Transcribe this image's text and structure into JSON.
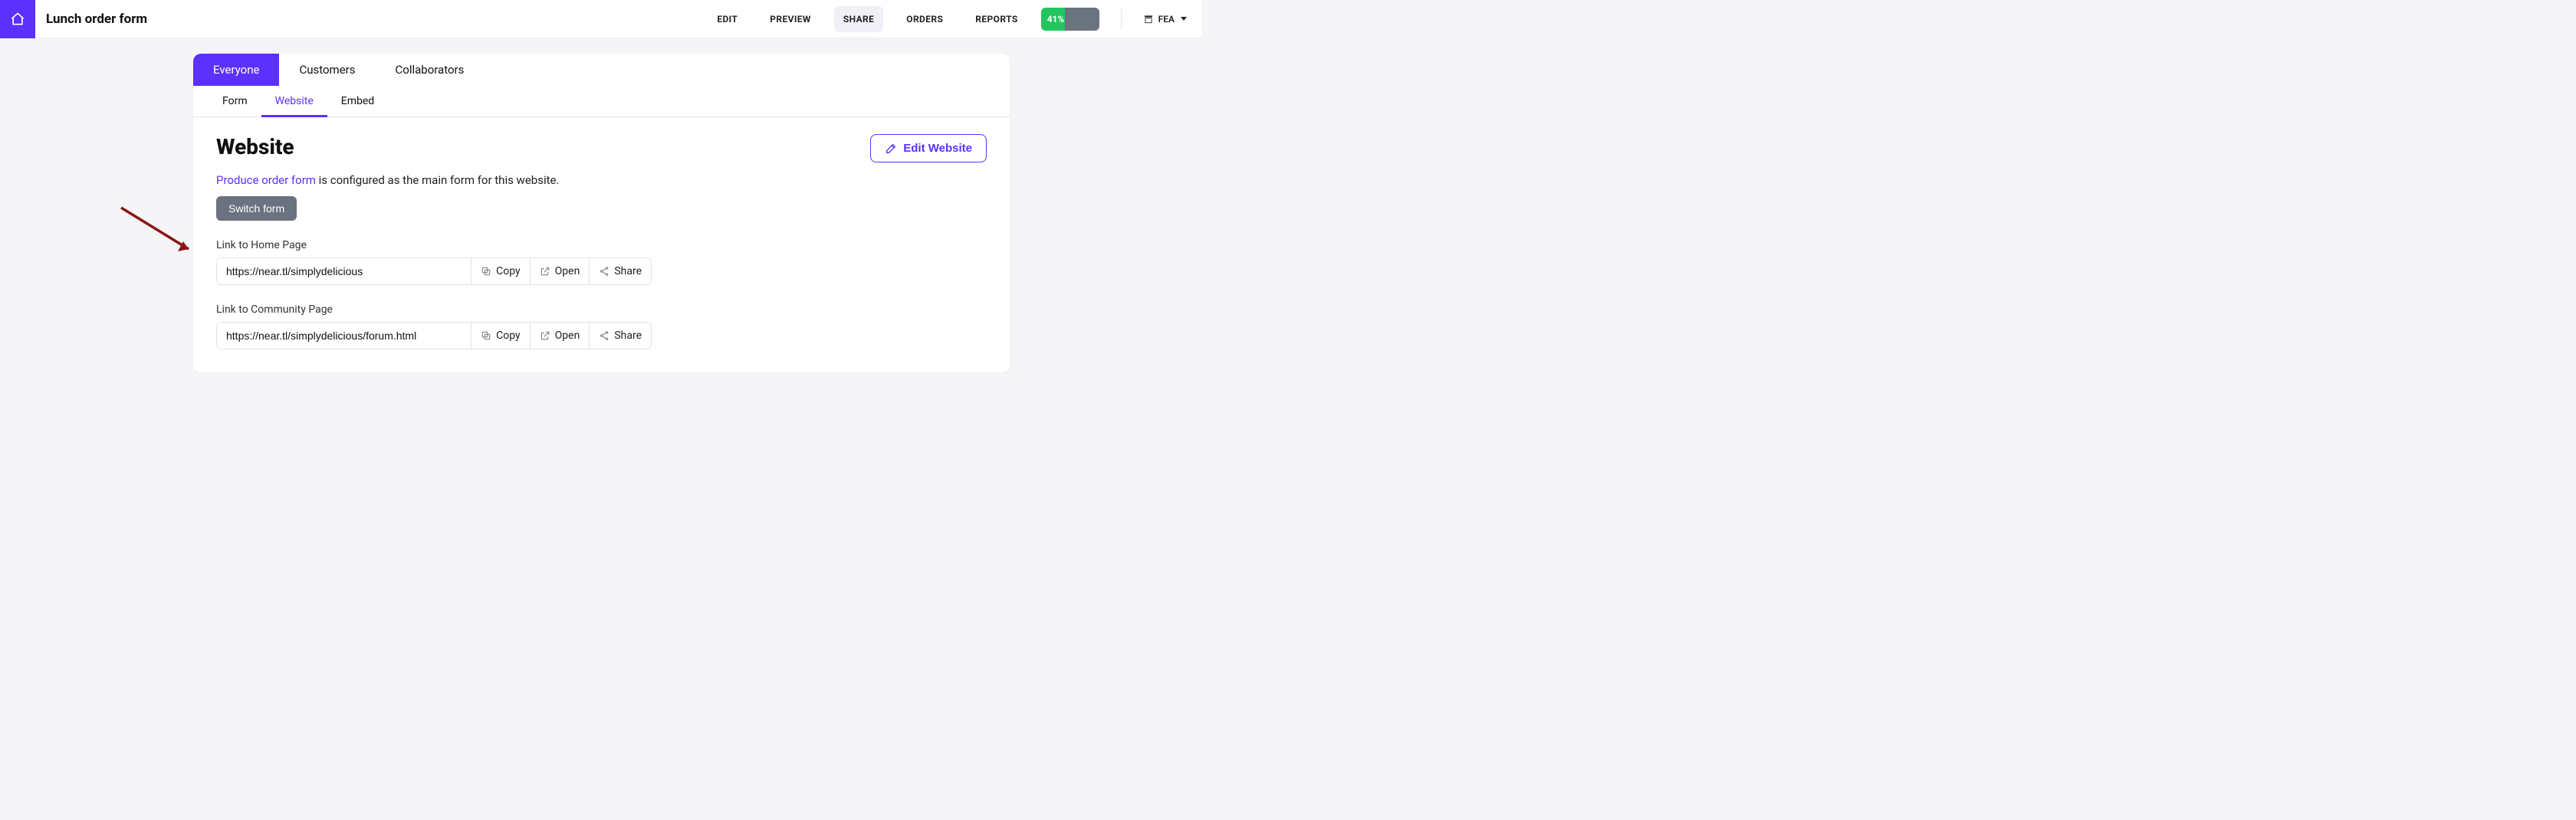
{
  "header": {
    "title": "Lunch order form",
    "nav": {
      "edit": "EDIT",
      "preview": "PREVIEW",
      "share": "SHARE",
      "orders": "ORDERS",
      "reports": "REPORTS"
    },
    "progress_label": "41%",
    "account_label": "FEA"
  },
  "tabs": {
    "everyone": "Everyone",
    "customers": "Customers",
    "collaborators": "Collaborators"
  },
  "subtabs": {
    "form": "Form",
    "website": "Website",
    "embed": "Embed"
  },
  "section": {
    "title": "Website",
    "edit_button": "Edit Website",
    "configured_link_text": "Produce order form",
    "configured_suffix": " is configured as the main form for this website.",
    "switch_button": "Switch form",
    "home": {
      "label": "Link to Home Page",
      "url": "https://near.tl/simplydelicious"
    },
    "community": {
      "label": "Link to Community Page",
      "url": "https://near.tl/simplydelicious/forum.html"
    },
    "actions": {
      "copy": "Copy",
      "open": "Open",
      "share": "Share"
    }
  }
}
